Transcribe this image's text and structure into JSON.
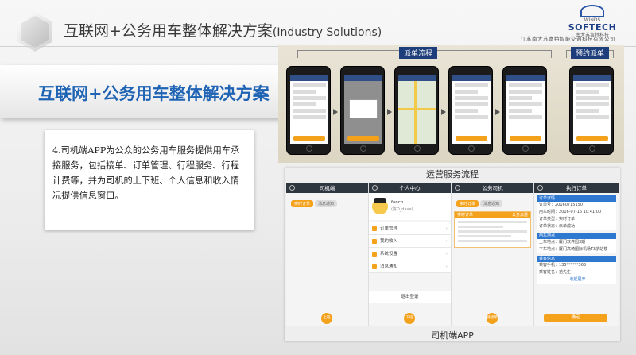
{
  "header": {
    "title_cn": "互联网+公务用车整体解决方案",
    "title_en": "(Industry Solutions)"
  },
  "logo": {
    "name": "SOFTECH",
    "sub": "WINDS",
    "brand_cn": "南大苏富特科技",
    "company_cn": "江苏南大苏富特智能交通科技有限公司"
  },
  "banner": {
    "title": "互联网+公务用车整体解决方案"
  },
  "description": {
    "text": "4.司机端APP为公众的公务用车服务提供用车承接服务，包括接单、订单管理、行程服务、行程计费等，并为司机的上下班、个人信息和收入情况提供信息窗口。"
  },
  "flow_panel": {
    "label_main": "派单流程",
    "label_booking": "预约派单"
  },
  "ops_panel": {
    "title": "运营服务流程",
    "app_label": "司机端APP",
    "screens": [
      {
        "title": "司机端",
        "tabs": [
          "实时订单",
          "消息通知"
        ],
        "fab": "上班"
      },
      {
        "title": "个人中心",
        "profile_name": "fanch",
        "profile_sub": "(陈D_dave)",
        "menu": [
          "订单管理",
          "我的收入",
          "系统设置",
          "消息通知"
        ],
        "logout": "退出登录",
        "fab": "下班"
      },
      {
        "title": "公务司机",
        "tabs": [
          "实时订单",
          "消息通知"
        ],
        "order_tag": "实时订单",
        "order_flag": "公务派遣",
        "fab": "待接单"
      },
      {
        "title": "执行订单",
        "section_order": "订单详情",
        "order_no": "订单号：20160715150",
        "use_time": "用车时间：2016-07-16 10:41:00",
        "order_type": "订单类型：实时订单",
        "order_status": "订单状态：派单成功",
        "section_address": "用车地点",
        "pickup": "上车地点：厦门软件园3期",
        "dropoff": "下车地点：厦门高崎国际机场T3航站楼",
        "section_passenger": "乘客信息",
        "passenger_phone": "乘客手机：135******363",
        "passenger_name": "乘客姓名：范先生",
        "collapse": "收起展开",
        "confirm": "确定"
      }
    ]
  },
  "colors": {
    "accent_blue": "#1f63b5",
    "accent_orange": "#f4a11b",
    "dark_nav": "#2e3640"
  }
}
